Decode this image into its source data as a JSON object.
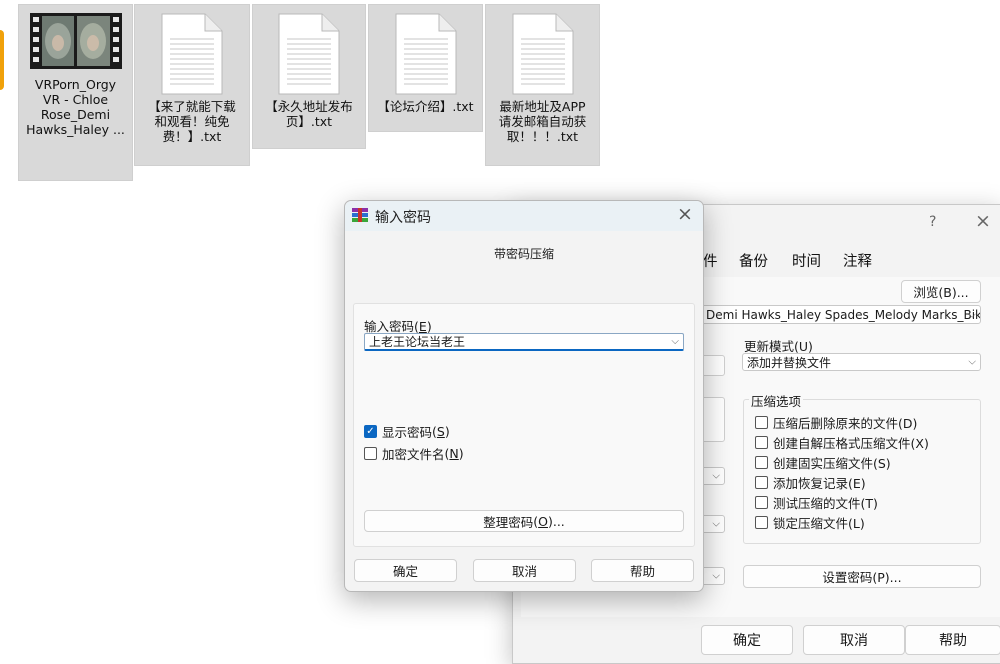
{
  "desktop": {
    "files": [
      {
        "name": "VRPorn_Orgy\nVR - Chloe\nRose_Demi\nHawks_Haley ...",
        "type": "video"
      },
      {
        "name": "【来了就能下载\n和观看！纯免\n费！】.txt",
        "type": "text"
      },
      {
        "name": "【永久地址发布\n页】.txt",
        "type": "text"
      },
      {
        "name": "【论坛介绍】.txt",
        "type": "text"
      },
      {
        "name": "最新地址及APP\n请发邮箱自动获\n取！！！.txt",
        "type": "text"
      }
    ]
  },
  "archive_dialog": {
    "help_glyph": "?",
    "close_glyph": "×",
    "tabs": [
      "件",
      "备份",
      "时间",
      "注释"
    ],
    "browse_button": "浏览(B)...",
    "archive_name": "Demi Hawks_Haley Spades_Melody Marks_Bikini Pa",
    "update_mode_label": "更新模式(U)",
    "update_mode_value": "添加并替换文件",
    "options_group_label": "压缩选项",
    "options": [
      {
        "label": "压缩后删除原来的文件(D)",
        "checked": false
      },
      {
        "label": "创建自解压格式压缩文件(X)",
        "checked": false
      },
      {
        "label": "创建固实压缩文件(S)",
        "checked": false
      },
      {
        "label": "添加恢复记录(E)",
        "checked": false
      },
      {
        "label": "测试压缩的文件(T)",
        "checked": false
      },
      {
        "label": "锁定压缩文件(L)",
        "checked": false
      }
    ],
    "set_password_button": "设置密码(P)...",
    "ok_button": "确定",
    "cancel_button": "取消",
    "help_button": "帮助"
  },
  "password_dialog": {
    "title": "输入密码",
    "close_glyph": "×",
    "subtitle": "带密码压缩",
    "input_label": "输入密码",
    "input_label_key": "E",
    "password_value": "上老王论坛当老王",
    "show_password_label": "显示密码",
    "show_password_key": "S",
    "show_password_checked": true,
    "encrypt_names_label": "加密文件名",
    "encrypt_names_key": "N",
    "encrypt_names_checked": false,
    "organize_button": "整理密码",
    "organize_key": "O",
    "organize_suffix": "...",
    "ok_button": "确定",
    "cancel_button": "取消",
    "help_button": "帮助"
  },
  "colors": {
    "accent": "#0b67c2",
    "file_tile": "#d9d9d9",
    "dialog_bg": "#f3f3f3"
  }
}
